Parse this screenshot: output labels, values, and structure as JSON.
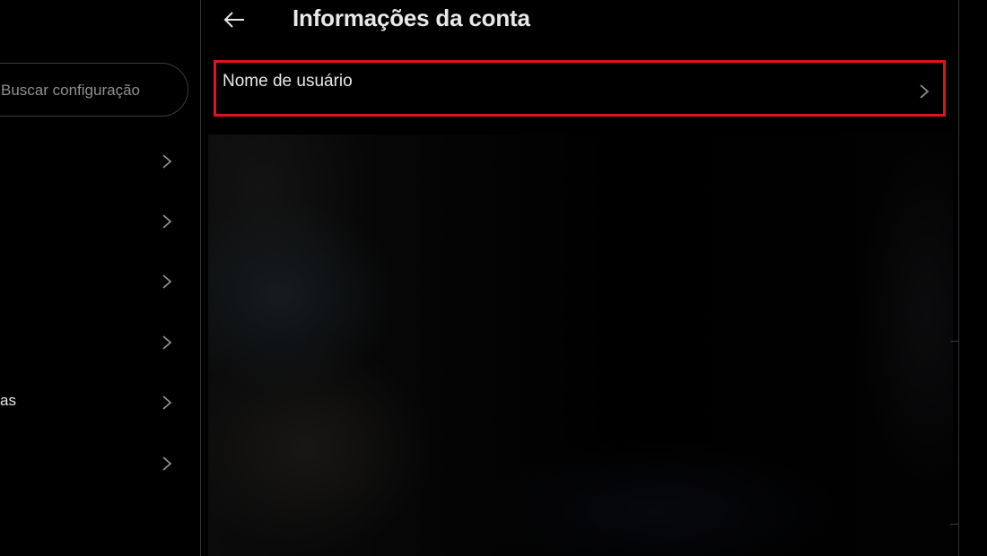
{
  "left_panel": {
    "search": {
      "placeholder_visible": "Buscar configuração",
      "icon": "search-icon"
    },
    "items": [
      {
        "label": "",
        "icon": "chevron-right-icon"
      },
      {
        "label": "",
        "icon": "chevron-right-icon"
      },
      {
        "label": "",
        "icon": "chevron-right-icon"
      },
      {
        "label": "",
        "icon": "chevron-right-icon"
      },
      {
        "label": "as",
        "icon": "chevron-right-icon"
      },
      {
        "label": "",
        "icon": "chevron-right-icon"
      }
    ]
  },
  "main": {
    "header": {
      "back_icon": "arrow-left-icon",
      "title": "Informações da conta"
    },
    "rows": [
      {
        "label": "Nome de usuário",
        "icon": "chevron-right-icon",
        "highlighted": true
      }
    ],
    "highlight_color": "#e0141b"
  },
  "colors": {
    "background": "#000000",
    "text_primary": "#e7e9ea",
    "text_secondary": "#8b8f94",
    "divider": "#2f3336",
    "chevron": "#8b8f94"
  }
}
